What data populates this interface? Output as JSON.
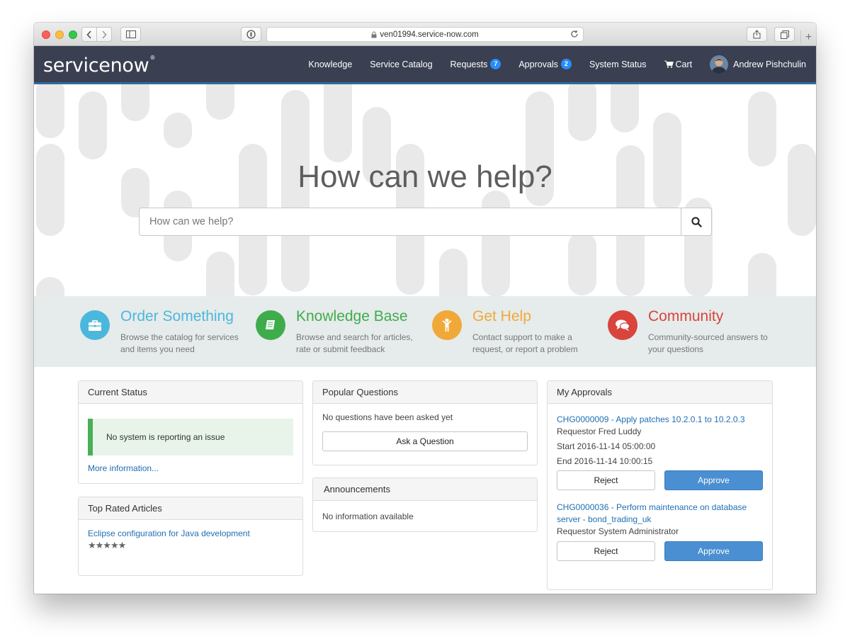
{
  "browser": {
    "url": "ven01994.service-now.com",
    "new_tab": "+"
  },
  "header": {
    "logo_service": "service",
    "logo_now": "now",
    "logo_reg": "®",
    "nav": [
      {
        "label": "Knowledge"
      },
      {
        "label": "Service Catalog"
      },
      {
        "label": "Requests",
        "badge": "7"
      },
      {
        "label": "Approvals",
        "badge": "2"
      },
      {
        "label": "System Status"
      },
      {
        "label": "Cart",
        "icon": "cart-icon"
      }
    ],
    "user_name": "Andrew Pishchulin",
    "colors": {
      "bar": "#3a3f51",
      "badge": "#278efc",
      "accent_line": "#2f6aa0"
    }
  },
  "hero": {
    "title": "How can we help?",
    "search_placeholder": "How can we help?"
  },
  "quick_links": [
    {
      "title": "Order Something",
      "desc": "Browse the catalog for services and items you need",
      "color": "#4cb7dc",
      "icon": "briefcase-icon"
    },
    {
      "title": "Knowledge Base",
      "desc": "Browse and search for articles, rate or submit feedback",
      "color": "#3fac4c",
      "icon": "book-icon"
    },
    {
      "title": "Get Help",
      "desc": "Contact support to make a request, or report a problem",
      "color": "#f0a938",
      "icon": "person-icon"
    },
    {
      "title": "Community",
      "desc": "Community-sourced answers to your questions",
      "color": "#d9443c",
      "icon": "chat-bubbles-icon"
    }
  ],
  "current_status": {
    "title": "Current Status",
    "alert": "No system is reporting an issue",
    "more": "More information..."
  },
  "top_rated": {
    "title": "Top Rated Articles",
    "article": "Eclipse configuration for Java development",
    "stars": "★★★★★",
    "rating": 5
  },
  "popular_questions": {
    "title": "Popular Questions",
    "empty": "No questions have been asked yet",
    "ask_button": "Ask a Question"
  },
  "announcements": {
    "title": "Announcements",
    "empty": "No information available"
  },
  "my_approvals": {
    "title": "My Approvals",
    "items": [
      {
        "link": "CHG0000009 - Apply patches 10.2.0.1 to 10.2.0.3",
        "requestor": "Requestor Fred Luddy",
        "start": "Start 2016-11-14 05:00:00",
        "end": "End 2016-11-14 10:00:15",
        "reject": "Reject",
        "approve": "Approve"
      },
      {
        "link": "CHG0000036 - Perform maintenance on database server - bond_trading_uk",
        "requestor": "Requestor System Administrator",
        "reject": "Reject",
        "approve": "Approve"
      }
    ]
  }
}
